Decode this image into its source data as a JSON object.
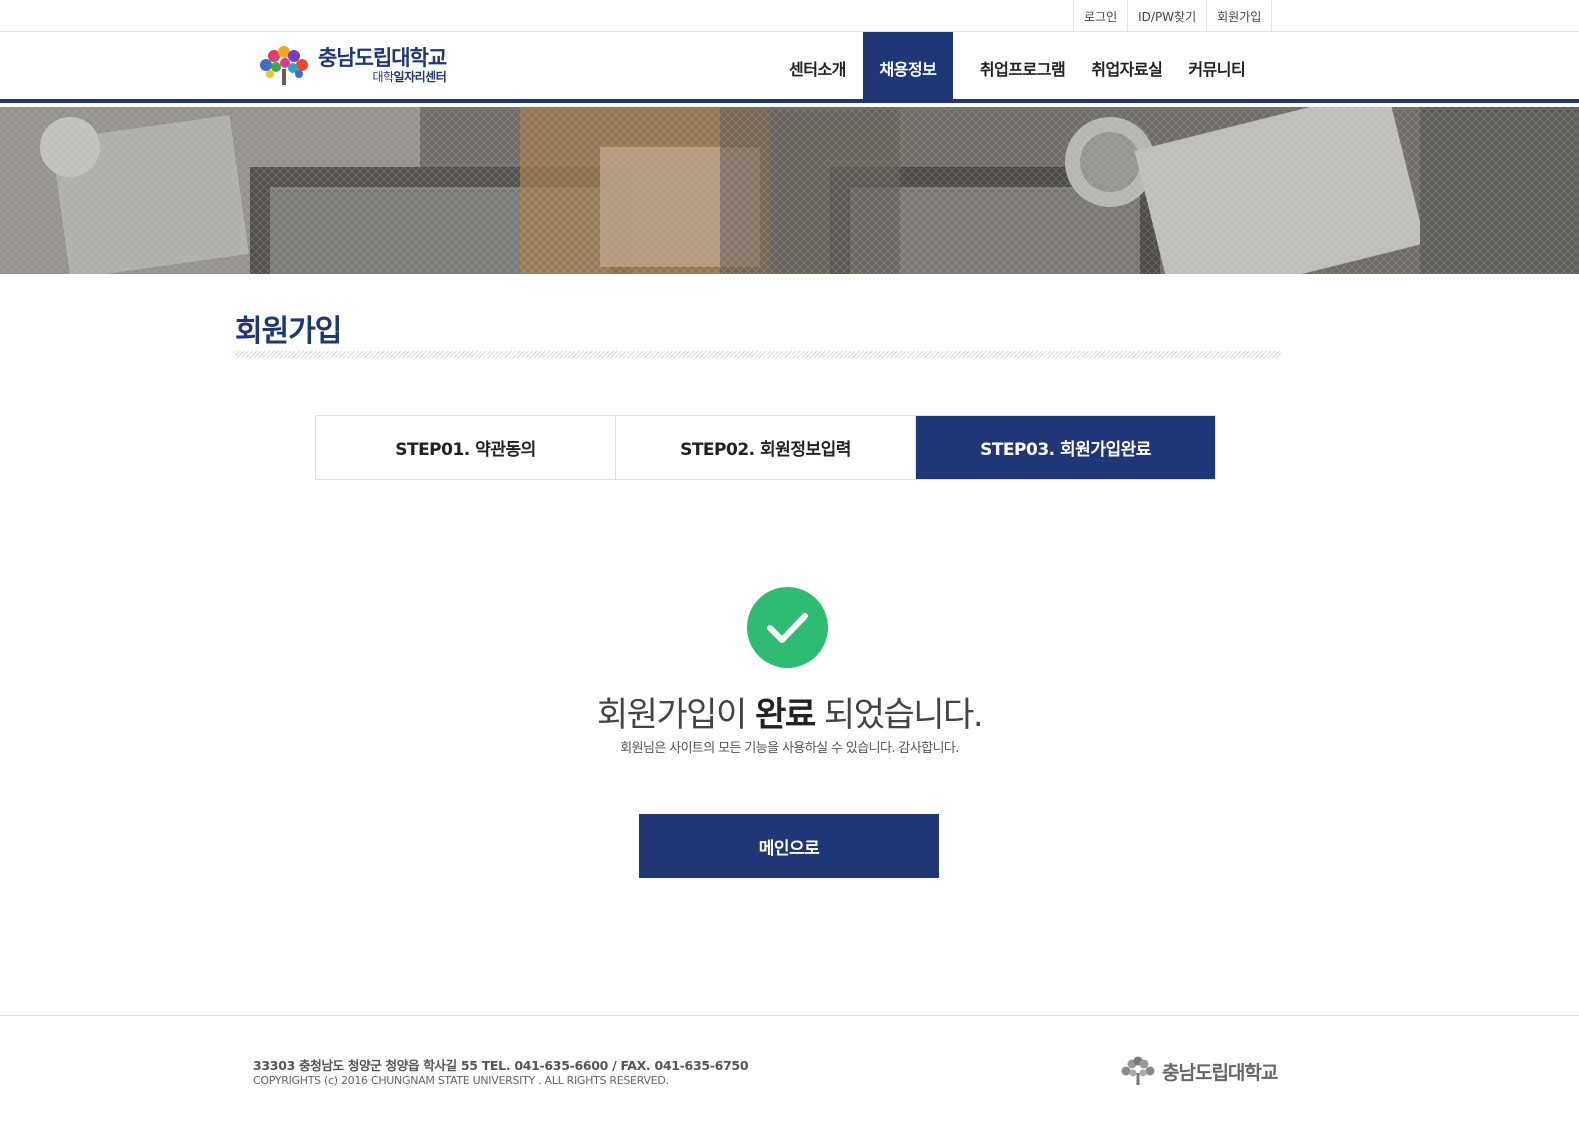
{
  "util_links": [
    {
      "label": "로그인"
    },
    {
      "label": "ID/PW찾기"
    },
    {
      "label": "회원가입"
    }
  ],
  "logo": {
    "main": "충남도립대학교",
    "sub_prefix": "대학",
    "sub_emphasis": "일자리센터"
  },
  "gnb": [
    {
      "label": "센터소개"
    },
    {
      "label": "채용정보"
    },
    {
      "label": "취업프로그램"
    },
    {
      "label": "취업자료실"
    },
    {
      "label": "커뮤니티"
    }
  ],
  "page_title": "회원가입",
  "steps": [
    {
      "label": "STEP01. 약관동의"
    },
    {
      "label": "STEP02. 회원정보입력"
    },
    {
      "label": "STEP03. 회원가입완료"
    }
  ],
  "completion": {
    "title_before": "회원가입이 ",
    "title_emphasis": "완료",
    "title_after": " 되었습니다.",
    "subtitle": "회원님은 사이트의 모든 기능을 사용하실 수 있습니다. 감사합니다.",
    "button_label": "메인으로"
  },
  "footer": {
    "address": "33303  충청남도 청양군 청양읍 학사길 55  TEL. 041-635-6600  /  FAX. 041-635-6750",
    "copyright": "COPYRIGHTS (c) 2016  CHUNGNAM STATE UNIVERSITY . ALL RIGHTS RESERVED.",
    "logo_text": "충남도립대학교"
  },
  "colors": {
    "brand": "#1f3677",
    "success": "#2ebb72"
  },
  "icons": {
    "check": "check-icon",
    "logo": "tree-logo-icon"
  }
}
